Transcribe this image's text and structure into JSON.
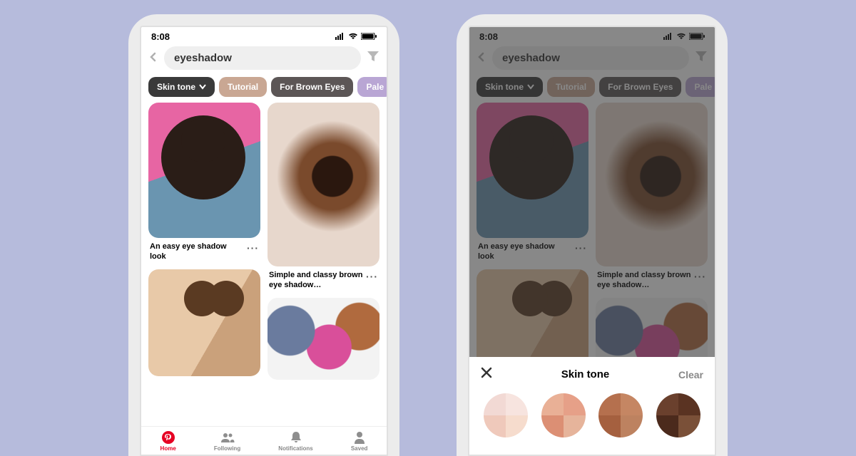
{
  "status": {
    "time": "8:08"
  },
  "search": {
    "query": "eyeshadow"
  },
  "chips": [
    {
      "label": "Skin tone",
      "bg": "#3a3a3a",
      "dropdown": true
    },
    {
      "label": "Tutorial",
      "bg": "#c9a793"
    },
    {
      "label": "For Brown Eyes",
      "bg": "#5c5656"
    },
    {
      "label": "Pale",
      "bg": "#b9a6d4"
    }
  ],
  "pins": [
    {
      "title": "An easy eye shadow look"
    },
    {
      "title": "Simple and classy brown eye shadow…"
    },
    {
      "title": ""
    },
    {
      "title": ""
    }
  ],
  "nav": {
    "home": "Home",
    "following": "Following",
    "notifications": "Notifications",
    "saved": "Saved"
  },
  "sheet": {
    "title": "Skin tone",
    "clear": "Clear",
    "swatches": [
      [
        "#f2d9d4",
        "#f7e4df",
        "#efc9bb",
        "#f6dccd"
      ],
      [
        "#e9b096",
        "#e6a088",
        "#dc8f74",
        "#e6b49b"
      ],
      [
        "#b5704e",
        "#c58663",
        "#a5603f",
        "#bd8260"
      ],
      [
        "#6a402d",
        "#5a3322",
        "#4b2a1c",
        "#7a5038"
      ]
    ]
  }
}
